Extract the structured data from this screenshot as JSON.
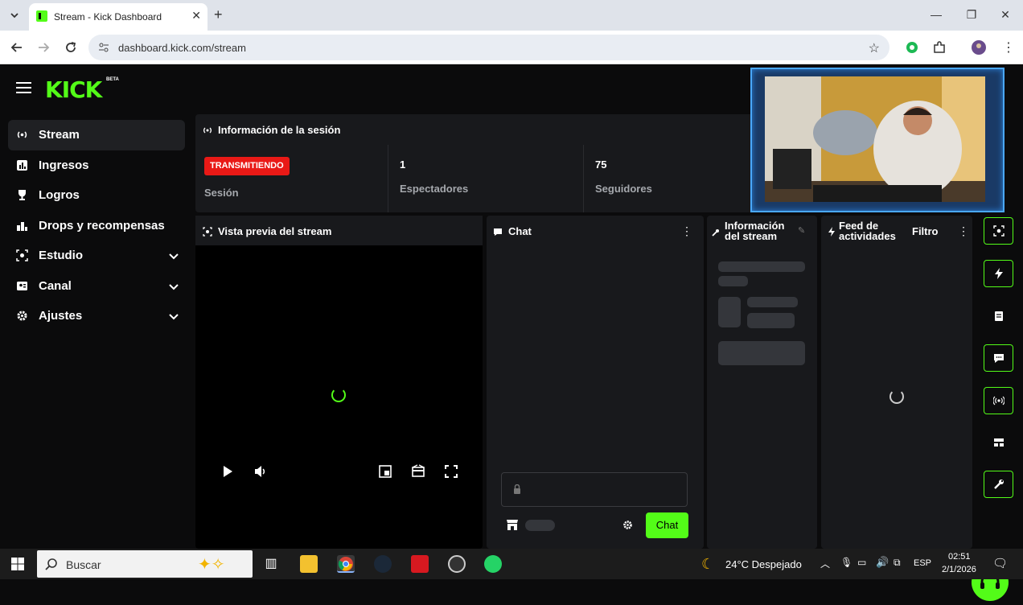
{
  "browser": {
    "tab_title": "Stream - Kick Dashboard",
    "url": "dashboard.kick.com/stream"
  },
  "kick": {
    "logo": "KICK",
    "logo_badge": "BETA",
    "sidebar": [
      {
        "label": "Stream",
        "icon": "broadcast-icon",
        "active": true
      },
      {
        "label": "Ingresos",
        "icon": "chart-icon"
      },
      {
        "label": "Logros",
        "icon": "trophy-icon"
      },
      {
        "label": "Drops y recompensas",
        "icon": "gift-icon"
      },
      {
        "label": "Estudio",
        "icon": "camera-icon",
        "expandable": true
      },
      {
        "label": "Canal",
        "icon": "user-icon",
        "expandable": true
      },
      {
        "label": "Ajustes",
        "icon": "gear-icon",
        "expandable": true
      }
    ],
    "session": {
      "title": "Información de la sesión",
      "live_badge": "TRANSMITIENDO",
      "session_label": "Sesión",
      "viewers_value": "1",
      "viewers_label": "Espectadores",
      "followers_value": "75",
      "followers_label": "Seguidores"
    },
    "preview": {
      "title": "Vista previa del stream"
    },
    "chat": {
      "title": "Chat",
      "send_label": "Chat"
    },
    "stream_info": {
      "title_line1": "Información",
      "title_line2": "del stream"
    },
    "feed": {
      "title_line1": "Feed de",
      "title_line2": "actividades",
      "filter_label": "Filtro"
    },
    "colors": {
      "brand": "#53fc18",
      "live": "#e91916"
    }
  },
  "taskbar": {
    "search_placeholder": "Buscar",
    "weather": "24°C  Despejado",
    "language": "ESP",
    "time": "02:51",
    "date": "2/1/2026"
  }
}
